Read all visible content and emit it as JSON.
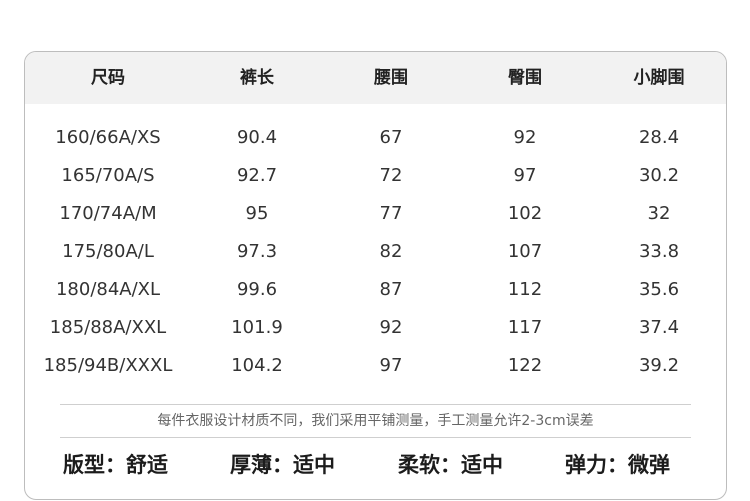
{
  "headers": [
    "尺码",
    "裤长",
    "腰围",
    "臀围",
    "小脚围"
  ],
  "rows": [
    [
      "160/66A/XS",
      "90.4",
      "67",
      "92",
      "28.4"
    ],
    [
      "165/70A/S",
      "92.7",
      "72",
      "97",
      "30.2"
    ],
    [
      "170/74A/M",
      "95",
      "77",
      "102",
      "32"
    ],
    [
      "175/80A/L",
      "97.3",
      "82",
      "107",
      "33.8"
    ],
    [
      "180/84A/XL",
      "99.6",
      "87",
      "112",
      "35.6"
    ],
    [
      "185/88A/XXL",
      "101.9",
      "92",
      "117",
      "37.4"
    ],
    [
      "185/94B/XXXL",
      "104.2",
      "97",
      "122",
      "39.2"
    ]
  ],
  "note": "每件衣服设计材质不同，我们采用平铺测量，手工测量允许2-3cm误差",
  "attributes": [
    {
      "label": "版型：",
      "value": "舒适"
    },
    {
      "label": "厚薄：",
      "value": "适中"
    },
    {
      "label": "柔软：",
      "value": "适中"
    },
    {
      "label": "弹力：",
      "value": "微弹"
    }
  ]
}
